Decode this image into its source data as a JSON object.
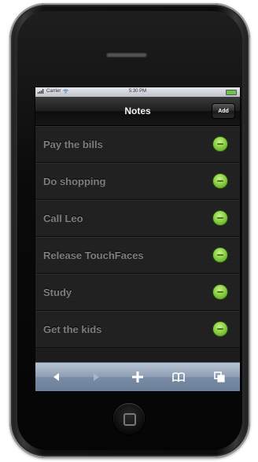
{
  "status_bar": {
    "carrier": "Carrier",
    "time": "5:30 PM"
  },
  "nav": {
    "title": "Notes",
    "add_label": "Add"
  },
  "notes": [
    {
      "label": "Pay the bills"
    },
    {
      "label": "Do shopping"
    },
    {
      "label": "Call Leo"
    },
    {
      "label": "Release TouchFaces"
    },
    {
      "label": "Study"
    },
    {
      "label": "Get the kids"
    }
  ],
  "toolbar": {
    "icons": [
      "back-icon",
      "forward-icon",
      "add-icon",
      "bookmarks-icon",
      "pages-icon"
    ]
  },
  "colors": {
    "check": "#8bd044",
    "toolbar": "#8d9db3",
    "note_text": "#7d7d7d"
  }
}
